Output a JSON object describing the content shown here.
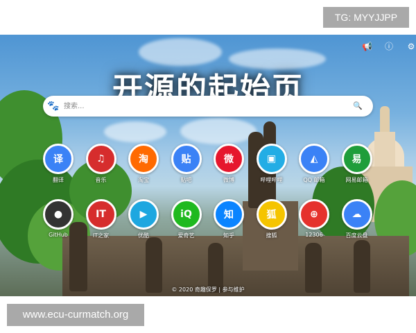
{
  "overlay": {
    "tg_badge": "TG: MYYJJPP",
    "watermark": "www.ecu-curmatch.org"
  },
  "topbar": {
    "icons": [
      "megaphone-icon",
      "info-icon",
      "gear-icon"
    ],
    "glyphs": [
      "📢",
      "ⓘ",
      "⚙"
    ]
  },
  "headline": "开源的起始页",
  "search": {
    "placeholder": "搜索...",
    "engine_icon": "baidu-paw-icon",
    "engine_glyph": "🐾",
    "submit_icon": "search-icon",
    "submit_glyph": "🔍"
  },
  "shortcuts": [
    {
      "label": "翻译",
      "icon": "translate-icon",
      "glyph": "译",
      "color": "#3b82f6"
    },
    {
      "label": "音乐",
      "icon": "netease-music-icon",
      "glyph": "♫",
      "color": "#d62d2d"
    },
    {
      "label": "淘宝",
      "icon": "taobao-icon",
      "glyph": "淘",
      "color": "#ff6a00"
    },
    {
      "label": "贴吧",
      "icon": "tieba-icon",
      "glyph": "贴",
      "color": "#3b82f6"
    },
    {
      "label": "微博",
      "icon": "weibo-icon",
      "glyph": "微",
      "color": "#e6162d"
    },
    {
      "label": "哔哩哔哩",
      "icon": "bilibili-icon",
      "glyph": "▣",
      "color": "#23ade5"
    },
    {
      "label": "QQ 邮箱",
      "icon": "qq-mail-icon",
      "glyph": "◭",
      "color": "#3b82f6"
    },
    {
      "label": "网易邮箱",
      "icon": "netease-mail-icon",
      "glyph": "易",
      "color": "#1f9d3a"
    },
    {
      "label": "GitHub",
      "icon": "github-icon",
      "glyph": "●",
      "color": "#333333"
    },
    {
      "label": "IT之家",
      "icon": "ithome-icon",
      "glyph": "IT",
      "color": "#d62d2d"
    },
    {
      "label": "优酷",
      "icon": "youku-icon",
      "glyph": "▶",
      "color": "#1ea7e0"
    },
    {
      "label": "爱奇艺",
      "icon": "iqiyi-icon",
      "glyph": "iQ",
      "color": "#1fb91f"
    },
    {
      "label": "知乎",
      "icon": "zhihu-icon",
      "glyph": "知",
      "color": "#0a84ff"
    },
    {
      "label": "搜狐",
      "icon": "sohu-icon",
      "glyph": "狐",
      "color": "#f5c400"
    },
    {
      "label": "12306",
      "icon": "12306-icon",
      "glyph": "⊕",
      "color": "#e5322d"
    },
    {
      "label": "百度云盘",
      "icon": "baidu-netdisk-icon",
      "glyph": "☁",
      "color": "#3b82f6"
    }
  ],
  "footer": "© 2020 奇趣保罗 | 参与维护"
}
